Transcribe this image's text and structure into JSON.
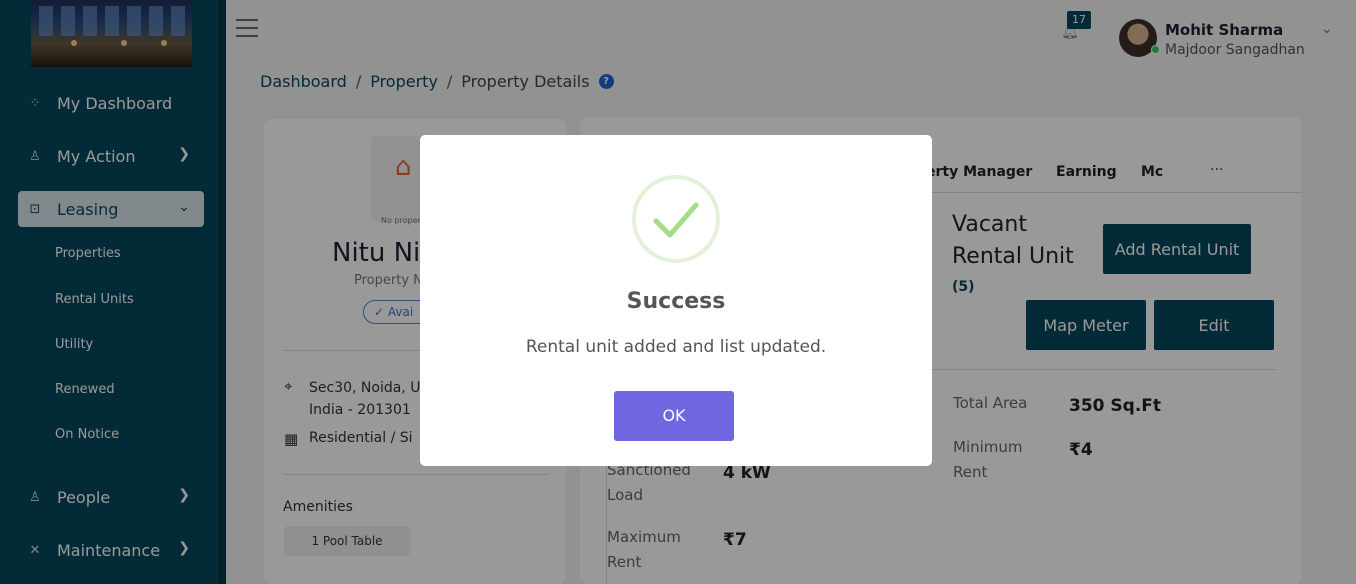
{
  "sidebar": {
    "items": [
      {
        "label": "My Dashboard",
        "icon": "grid-icon"
      },
      {
        "label": "My Action",
        "icon": "user-icon"
      },
      {
        "label": "Leasing",
        "icon": "lock-icon"
      },
      {
        "label": "People",
        "icon": "people-icon"
      },
      {
        "label": "Maintenance",
        "icon": "tools-icon"
      }
    ],
    "subitems": [
      "Properties",
      "Rental Units",
      "Utility",
      "Renewed",
      "On Notice"
    ]
  },
  "header": {
    "notification_count": "17",
    "user_name": "Mohit Sharma",
    "user_org": "Majdoor Sangadhan"
  },
  "breadcrumb": {
    "items": [
      "Dashboard",
      "Property",
      "Property Details"
    ],
    "separator": "/",
    "help": "?"
  },
  "property": {
    "no_image_text": "No property image",
    "name": "Nitu Ni",
    "subtitle": "Property N",
    "status": "Avai",
    "address_line1": "Sec30, Noida, U",
    "address_line2": "India - 201301",
    "type": "Residential  /  Si",
    "amenities_title": "Amenities",
    "amenities": [
      "1 Pool Table"
    ]
  },
  "tabs": {
    "items": [
      "erty Manager",
      "Earning",
      "Mc"
    ],
    "more": "···"
  },
  "vacant": {
    "line1": "Vacant",
    "line2": "Rental Unit",
    "count": "(5)"
  },
  "actions": {
    "add_rental_unit": "Add Rental Unit",
    "map_meter": "Map Meter",
    "edit": "Edit"
  },
  "details": {
    "sanctioned_load_label": "Sanctioned Load",
    "sanctioned_load_value": "4 kW",
    "max_rent_label": "Maximum Rent",
    "max_rent_value": "₹7",
    "total_area_label": "Total Area",
    "total_area_value": "350 Sq.Ft",
    "min_rent_label": "Minimum Rent",
    "min_rent_value": "₹4"
  },
  "modal": {
    "title": "Success",
    "message": "Rental unit added and list updated.",
    "ok_label": "OK"
  },
  "colors": {
    "sidebar": "#04485d",
    "primary": "#04485d",
    "ok_button": "#7066e0",
    "success_check": "#a5dc86"
  }
}
